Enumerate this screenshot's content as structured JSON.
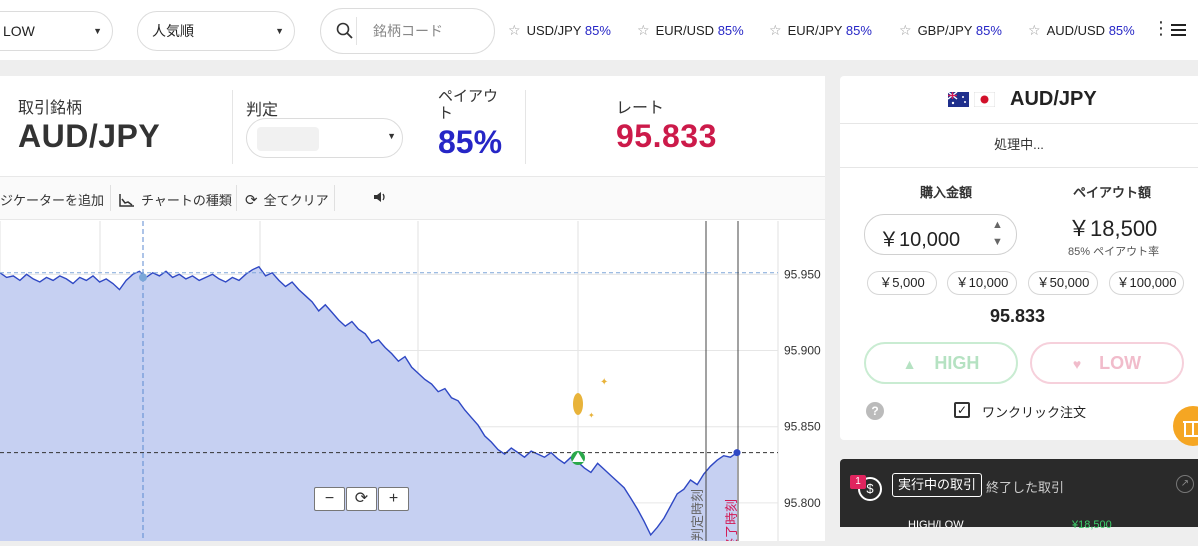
{
  "topbar": {
    "sort_select": "LOW",
    "order_select": "人気順",
    "search_placeholder": "銘柄コード",
    "favorites": [
      {
        "pair": "USD/JPY",
        "payout": "85%"
      },
      {
        "pair": "EUR/USD",
        "payout": "85%"
      },
      {
        "pair": "EUR/JPY",
        "payout": "85%"
      },
      {
        "pair": "GBP/JPY",
        "payout": "85%"
      },
      {
        "pair": "AUD/USD",
        "payout": "85%"
      }
    ]
  },
  "info": {
    "pair_label": "取引銘柄",
    "pair": "AUD/JPY",
    "judge_label": "判定",
    "payout_label": "ペイアウト",
    "payout": "85%",
    "rate_label": "レート",
    "rate": "95.833"
  },
  "toolbar": {
    "indicator": "ジケーターを追加",
    "chart_type": "チャートの種類",
    "clear_all": "全てクリア"
  },
  "chart_data": {
    "type": "area",
    "y_ticks": [
      "95.950",
      "95.900",
      "95.850",
      "95.800"
    ],
    "ylim": [
      95.775,
      95.985
    ],
    "current_price": 95.833,
    "reference_price": 95.951,
    "series": [
      {
        "values": [
          95.951,
          95.948,
          95.949,
          95.946,
          95.95,
          95.947,
          95.945,
          95.948,
          95.946,
          95.949,
          95.947,
          95.944,
          95.948,
          95.946,
          95.949,
          95.945,
          95.947,
          95.944,
          95.94,
          95.946,
          95.95,
          95.952,
          95.948,
          95.951,
          95.949,
          95.952,
          95.948,
          95.95,
          95.947,
          95.949,
          95.946,
          95.948,
          95.95,
          95.947,
          95.945,
          95.948,
          95.946,
          95.95,
          95.953,
          95.955,
          95.949,
          95.951,
          95.946,
          95.942,
          95.945,
          95.94,
          95.936,
          95.932,
          95.926,
          95.93,
          95.925,
          95.92,
          95.916,
          95.919,
          95.914,
          95.911,
          95.905,
          95.907,
          95.902,
          95.898,
          95.893,
          95.896,
          95.889,
          95.885,
          95.881,
          95.878,
          95.873,
          95.875,
          95.869,
          95.867,
          95.861,
          95.856,
          95.851,
          95.844,
          95.84,
          95.835,
          95.832,
          95.836,
          95.833,
          95.83,
          95.834,
          95.832,
          95.83,
          95.833,
          95.829,
          95.826,
          95.83,
          95.827,
          95.823,
          95.82,
          95.826,
          95.822,
          95.818,
          95.814,
          95.81,
          95.803,
          95.796,
          95.788,
          95.779,
          95.784,
          95.79,
          95.798,
          95.806,
          95.809,
          95.815,
          95.812,
          95.819,
          95.824,
          95.828,
          95.831,
          95.83,
          95.833
        ]
      }
    ],
    "markers": {
      "deadline_label": "判定時刻",
      "end_label": "終了時刻"
    }
  },
  "zoom": {
    "minus": "−",
    "reset": "⟳",
    "plus": "+"
  },
  "side": {
    "pair": "AUD/JPY",
    "status": "処理中...",
    "amount_label": "購入金額",
    "payout_label": "ペイアウト額",
    "amount": "￥10,000",
    "payout_amount": "￥18,500",
    "payout_rate": "85% ペイアウト率",
    "presets": [
      "￥5,000",
      "￥10,000",
      "￥50,000",
      "￥100,000"
    ],
    "rate": "95.833",
    "high": "HIGH",
    "low": "LOW",
    "oneclick": "ワンクリック注文",
    "help": "?"
  },
  "trades": {
    "badge": "1",
    "active_tab": "実行中の取引",
    "done_tab": "終了した取引",
    "peek_type": "HIGH/LOW",
    "peek_amount": "¥18,500"
  },
  "colors": {
    "payout_blue": "#2626c6",
    "rate_red": "#cc1a4a",
    "chart_fill": "#c6d0f2",
    "chart_line": "#2f48c4",
    "high_green": "#b5e2c2",
    "low_pink": "#f1bccb"
  }
}
